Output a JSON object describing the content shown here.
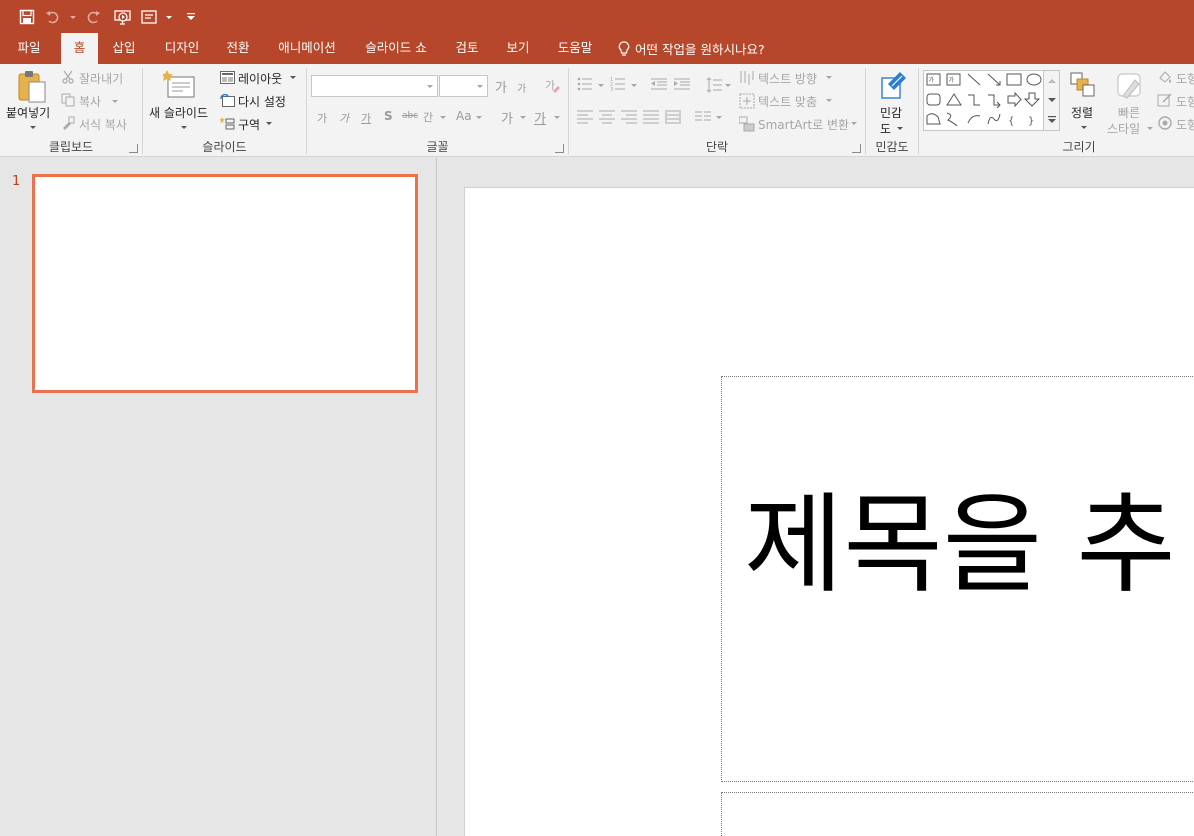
{
  "colors": {
    "accent": "#b7472a",
    "thumb_border": "#e8734e",
    "ribbon_bg": "#f3f3f3"
  },
  "qat": {
    "icons": [
      "save-icon",
      "undo-icon",
      "redo-icon",
      "start-from-beginning-icon",
      "touch-mode-icon",
      "customize-qat-icon"
    ]
  },
  "tabs": [
    {
      "label": "파일"
    },
    {
      "label": "홈"
    },
    {
      "label": "삽입"
    },
    {
      "label": "디자인"
    },
    {
      "label": "전환"
    },
    {
      "label": "애니메이션"
    },
    {
      "label": "슬라이드 쇼"
    },
    {
      "label": "검토"
    },
    {
      "label": "보기"
    },
    {
      "label": "도움말"
    }
  ],
  "tellme": {
    "label": "어떤 작업을 원하시나요?"
  },
  "ribbon": {
    "clipboard": {
      "label": "클립보드",
      "paste": "붙여넣기",
      "cut": "잘라내기",
      "copy": "복사",
      "format_painter": "서식 복사"
    },
    "slides": {
      "label": "슬라이드",
      "new_slide": "새 슬라이드",
      "layout": "레이아웃",
      "reset": "다시 설정",
      "section": "구역"
    },
    "font": {
      "label": "글꼴",
      "font_name": "",
      "font_size": "",
      "grow": "가",
      "shrink": "가",
      "bold": "가",
      "italic": "가",
      "underline": "가",
      "shadow": "S",
      "strike": "abc",
      "spacing": "간",
      "case": "Aa",
      "highlight": "가",
      "color": "가"
    },
    "paragraph": {
      "label": "단락",
      "text_direction": "텍스트 방향",
      "align_text": "텍스트 맞춤",
      "smartart": "SmartArt로 변환"
    },
    "sensitivity": {
      "label": "민감도",
      "button_line1": "민감",
      "button_line2": "도"
    },
    "drawing": {
      "label": "그리기",
      "arrange": "정렬",
      "quick_styles_line1": "빠른",
      "quick_styles_line2": "스타일",
      "shape_fill": "도형",
      "shape_outline": "도형",
      "shape_effects": "도형"
    }
  },
  "thumbnails": [
    {
      "number": "1"
    }
  ],
  "slide": {
    "title_placeholder": "제목을 추"
  }
}
